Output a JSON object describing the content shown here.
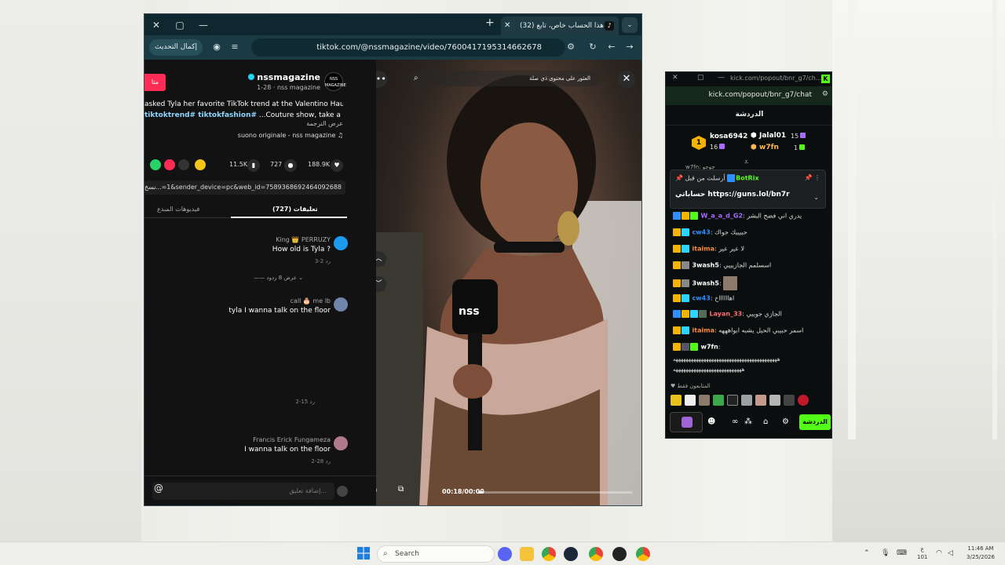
{
  "browser": {
    "tab_title": "هذا الحساب خاص، تابع (32)",
    "update_button": "إكمال التحديث",
    "url": "tiktok.com/@nssmagazine/video/7600417195314662678"
  },
  "tiktok": {
    "follow_label": "متا",
    "avatar_text": "NSS MAGAZINE",
    "author_name": "nssmagazine",
    "author_sub": "1-28 · nss magazine",
    "caption_line1": "asked Tyla her favorite TikTok trend at the Valentino Haute",
    "caption_line2_tags": "tiktoktrend# tiktokfashion#",
    "caption_line2_text": "...Couture show, take a look!",
    "translate": "عرض الترجمة",
    "music": "suono originale - nss magazine",
    "likes": "188.9K",
    "comments": "727",
    "saves": "11.5K",
    "share_link": "...=1&sender_device=pc&web_id=7589368692464092688",
    "share_link_label": "نسخ",
    "tab_comments": "تعليقات (727)",
    "tab_creator_videos": "فيديوهات المبدع",
    "comment_list": [
      {
        "user": "King 👑 PERRUZY",
        "text": "How old is Tyla ?",
        "meta": "3-2   رد",
        "more": "—— عرض 8 ردود ⌄"
      },
      {
        "user": "call 🎂 me lb",
        "text": "tyla I wanna talk on the floor",
        "meta": "",
        "more": ""
      },
      {
        "user": "",
        "text": "",
        "meta": "2-15   رد",
        "more": ""
      },
      {
        "user": "Francis Erick Fungameza",
        "text": "I wanna talk on the floor",
        "meta": "2-28   رد",
        "more": ""
      }
    ],
    "input_placeholder": "إضافة تعليق...",
    "input_at": "@"
  },
  "video": {
    "search_placeholder": "العثور على محتوى ذي صلة",
    "time": "00:18/00:00",
    "progress": 0.03,
    "mic_brand": "nss"
  },
  "kick": {
    "window_url_title": "kick.com/popout/bnr_g7/ch...",
    "address_url": "kick.com/popout/bnr_g7/chat",
    "header_title": "الدردشة",
    "leaderboard": [
      {
        "rank": "1",
        "name": "kosa6942",
        "value": "16"
      },
      {
        "rank": "",
        "name": "Jalal01",
        "value": "15"
      },
      {
        "rank": "",
        "name": "w7fn",
        "value": "1"
      }
    ],
    "pinned_partial": "w7fn: جوجو",
    "pinned_header": "أرسلت من قبل",
    "pinned_by": "BotRix",
    "pinned_link": "حساباتي https://guns.lol/bn7r",
    "messages": [
      {
        "user": "W_a_a_d_G2",
        "user_color": "#a86bff",
        "text": "يدري اني فضح البشر"
      },
      {
        "user": "cw43",
        "user_color": "#2f8fff",
        "text": "حبيييك جواك"
      },
      {
        "user": "itaima",
        "user_color": "#ff8a3d",
        "text": "لا عير عير"
      },
      {
        "user": "3wash5",
        "user_color": "#ffffff",
        "text": "اسسلمم الجازيييي"
      },
      {
        "user": "3wash5",
        "user_color": "#ffffff",
        "text": ""
      },
      {
        "user": "cw43",
        "user_color": "#2f8fff",
        "text": "اهااااااخ"
      },
      {
        "user": "Layan_33",
        "user_color": "#ff6b6b",
        "text": "الجازي جوييي"
      },
      {
        "user": "itaima",
        "user_color": "#ff8a3d",
        "text": "اسمر حبيبي الحيل يشبه ابواهههه"
      },
      {
        "user": "w7fn",
        "user_color": "#ffffff",
        "text": ""
      }
    ],
    "long_line_1": "هههههههههههههههههههههههههههههههههههههههههه",
    "long_line_2": "هههههههههههههههههههههههههههه",
    "followers_only": "المتابعون فقط",
    "send_button": "الدردشة"
  },
  "taskbar": {
    "search_label": "Search",
    "lang": "ع",
    "lang_sub": "101",
    "time": "11:46 AM",
    "date": "3/25/2026"
  },
  "colors": {
    "tiktok_red": "#fe2c55",
    "kick_green": "#53fc18",
    "browser_chrome": "#1a3b44"
  }
}
